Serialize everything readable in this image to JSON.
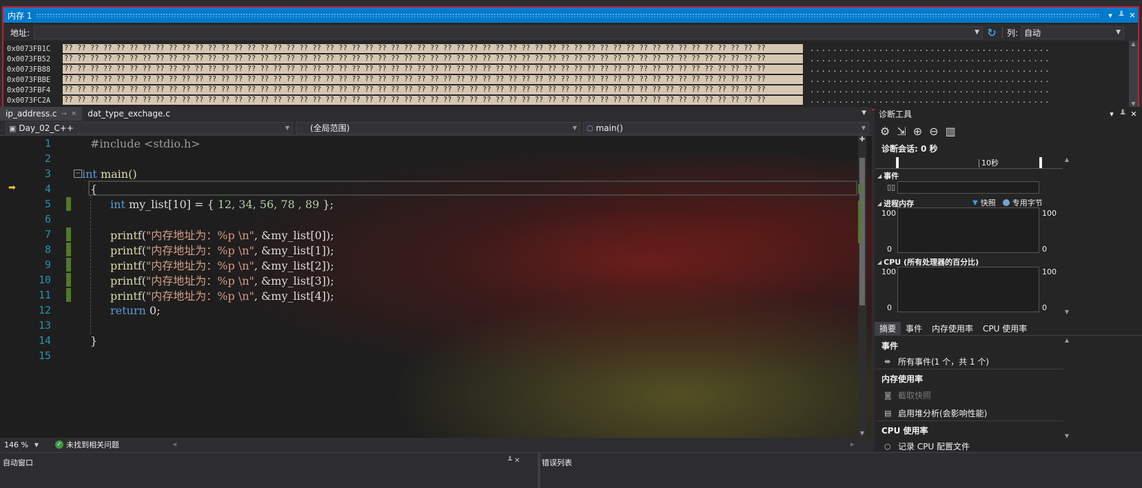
{
  "memory_window": {
    "title": "内存 1",
    "address_label": "地址:",
    "address_value": "",
    "columns_label": "列:",
    "columns_value": "自动",
    "rows": [
      {
        "address": "0x0073FB1C",
        "hex": "?? ?? ?? ?? ?? ?? ?? ?? ?? ?? ?? ?? ?? ?? ?? ?? ?? ?? ?? ?? ?? ?? ?? ?? ?? ?? ?? ?? ?? ?? ?? ?? ?? ?? ?? ?? ?? ?? ?? ?? ?? ?? ?? ?? ?? ?? ?? ?? ?? ?? ?? ?? ?? ??",
        "ascii": "......................................................"
      },
      {
        "address": "0x0073FB52",
        "hex": "?? ?? ?? ?? ?? ?? ?? ?? ?? ?? ?? ?? ?? ?? ?? ?? ?? ?? ?? ?? ?? ?? ?? ?? ?? ?? ?? ?? ?? ?? ?? ?? ?? ?? ?? ?? ?? ?? ?? ?? ?? ?? ?? ?? ?? ?? ?? ?? ?? ?? ?? ?? ?? ??",
        "ascii": "......................................................"
      },
      {
        "address": "0x0073FB88",
        "hex": "?? ?? ?? ?? ?? ?? ?? ?? ?? ?? ?? ?? ?? ?? ?? ?? ?? ?? ?? ?? ?? ?? ?? ?? ?? ?? ?? ?? ?? ?? ?? ?? ?? ?? ?? ?? ?? ?? ?? ?? ?? ?? ?? ?? ?? ?? ?? ?? ?? ?? ?? ?? ?? ??",
        "ascii": "......................................................"
      },
      {
        "address": "0x0073FBBE",
        "hex": "?? ?? ?? ?? ?? ?? ?? ?? ?? ?? ?? ?? ?? ?? ?? ?? ?? ?? ?? ?? ?? ?? ?? ?? ?? ?? ?? ?? ?? ?? ?? ?? ?? ?? ?? ?? ?? ?? ?? ?? ?? ?? ?? ?? ?? ?? ?? ?? ?? ?? ?? ?? ?? ??",
        "ascii": "......................................................"
      },
      {
        "address": "0x0073FBF4",
        "hex": "?? ?? ?? ?? ?? ?? ?? ?? ?? ?? ?? ?? ?? ?? ?? ?? ?? ?? ?? ?? ?? ?? ?? ?? ?? ?? ?? ?? ?? ?? ?? ?? ?? ?? ?? ?? ?? ?? ?? ?? ?? ?? ?? ?? ?? ?? ?? ?? ?? ?? ?? ?? ?? ??",
        "ascii": "......................................................"
      },
      {
        "address": "0x0073FC2A",
        "hex": "?? ?? ?? ?? ?? ?? ?? ?? ?? ?? ?? ?? ?? ?? ?? ?? ?? ?? ?? ?? ?? ?? ?? ?? ?? ?? ?? ?? ?? ?? ?? ?? ?? ?? ?? ?? ?? ?? ?? ?? ?? ?? ?? ?? ?? ?? ?? ?? ?? ?? ?? ?? ?? ??",
        "ascii": "......................................................"
      }
    ]
  },
  "editor": {
    "tabs": [
      {
        "label": "ip_address.c",
        "active": true
      },
      {
        "label": "dat_type_exchage.c",
        "active": false
      }
    ],
    "nav": {
      "project": "Day_02_C++",
      "scope": "(全局范围)",
      "member": "main()"
    },
    "code": {
      "l1": "#include <stdio.h>",
      "l3_kw": "int",
      "l3_rest": " main()",
      "l4": "{",
      "l5_kw": "int",
      "l5_name": " my_list[10] = { ",
      "l5_vals": "12, 34, 56, 78 , 89",
      "l5_end": " };",
      "printf_fn": "printf",
      "printf_str": "\"内存地址为：%p \\n\"",
      "printf_args": [
        ", &my_list[0]);",
        ", &my_list[1]);",
        ", &my_list[2]);",
        ", &my_list[3]);",
        ", &my_list[4]);"
      ],
      "l12_kw": "return",
      "l12_val": " 0;",
      "l14": "}"
    },
    "line_numbers": [
      "1",
      "2",
      "3",
      "4",
      "5",
      "6",
      "7",
      "8",
      "9",
      "10",
      "11",
      "12",
      "13",
      "14",
      "15"
    ],
    "zoom": "146 %",
    "issues": "未找到相关问题"
  },
  "diagnostics": {
    "title": "诊断工具",
    "session": "诊断会话: 0 秒",
    "timeline_label": "10秒",
    "events_header": "事件",
    "process_memory_header": "进程内存",
    "legend_snapshot": "快照",
    "legend_private": "专用字节",
    "mem_max": "100",
    "mem_min": "0",
    "cpu_header": "CPU (所有处理器的百分比)",
    "cpu_max": "100",
    "cpu_min": "0",
    "tabs": [
      "摘要",
      "事件",
      "内存使用率",
      "CPU 使用率"
    ],
    "summary": {
      "events_head": "事件",
      "all_events": "所有事件(1 个，共 1 个)",
      "memory_head": "内存使用率",
      "take_snapshot": "截取快照",
      "heap_analysis": "启用堆分析(会影响性能)",
      "cpu_head": "CPU 使用率",
      "record_cpu": "记录 CPU 配置文件"
    }
  },
  "bottom": {
    "left_title": "自动窗口",
    "right_title": "错误列表"
  }
}
